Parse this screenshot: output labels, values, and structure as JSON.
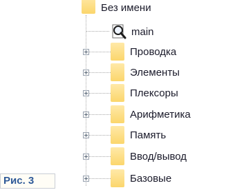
{
  "tree": {
    "root": {
      "label": "Без имени",
      "icon": "folder-icon"
    },
    "child": {
      "label": "main",
      "icon": "magnifier-document-icon"
    },
    "items": [
      {
        "label": "Проводка",
        "icon": "folder-icon",
        "expander": "plus-icon"
      },
      {
        "label": "Элементы",
        "icon": "folder-icon",
        "expander": "plus-icon"
      },
      {
        "label": "Плексоры",
        "icon": "folder-icon",
        "expander": "plus-icon"
      },
      {
        "label": "Арифметика",
        "icon": "folder-icon",
        "expander": "plus-icon"
      },
      {
        "label": "Память",
        "icon": "folder-icon",
        "expander": "plus-icon"
      },
      {
        "label": "Ввод/вывод",
        "icon": "folder-icon",
        "expander": "plus-icon"
      },
      {
        "label": "Базовые",
        "icon": "folder-icon",
        "expander": "plus-icon"
      }
    ]
  },
  "figure_label": "Рис. 3",
  "colors": {
    "folder": "#fbd66c",
    "text": "#1a1a2a",
    "caption": "#2f5a98"
  }
}
